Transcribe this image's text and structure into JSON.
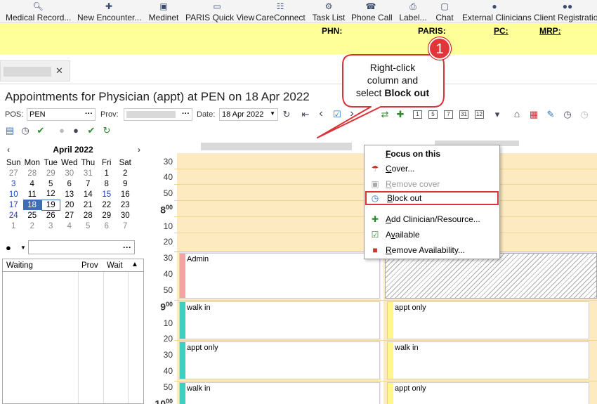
{
  "toolbar": {
    "items": [
      {
        "label": "Medical Record...",
        "icon": "search-icon"
      },
      {
        "label": "New Encounter...",
        "icon": "new-encounter-icon"
      },
      {
        "label": "Medinet",
        "icon": "medinet-icon"
      },
      {
        "label": "PARIS Quick View",
        "icon": "window-icon"
      },
      {
        "label": "CareConnect",
        "icon": "careconnect-icon"
      },
      {
        "label": "Task List",
        "icon": "gears-icon"
      },
      {
        "label": "Phone Call",
        "icon": "phone-icon"
      },
      {
        "label": "Label...",
        "icon": "printer-icon"
      },
      {
        "label": "Chat",
        "icon": "chat-icon"
      },
      {
        "label": "External Clinicians",
        "icon": "person-icon"
      },
      {
        "label": "Client Registration",
        "icon": "people-icon"
      }
    ]
  },
  "patient_banner": {
    "phn_label": "PHN:",
    "paris_label": "PARIS:",
    "pc_label": "PC:",
    "mrp_label": "MRP:"
  },
  "tab": {
    "close_glyph": "✕"
  },
  "page_title": "Appointments for Physician (appt) at PEN on 18 Apr 2022",
  "filters": {
    "pos_label": "POS:",
    "pos_value": "PEN",
    "prov_label": "Prov:",
    "date_label": "Date:",
    "date_value": "18 Apr 2022",
    "ellipsis": "···",
    "calendar_boxes": [
      "1",
      "5",
      "7",
      "31",
      "12"
    ]
  },
  "calendar": {
    "month_label": "April 2022",
    "weekdays": [
      "Sun",
      "Mon",
      "Tue",
      "Wed",
      "Thu",
      "Fri",
      "Sat"
    ],
    "weeks": [
      [
        "27",
        "28",
        "29",
        "30",
        "31",
        "1",
        "2"
      ],
      [
        "3",
        "4",
        "5",
        "6",
        "7",
        "8",
        "9"
      ],
      [
        "10",
        "11",
        "12",
        "13",
        "14",
        "15",
        "16"
      ],
      [
        "17",
        "18",
        "19",
        "20",
        "21",
        "22",
        "23"
      ],
      [
        "24",
        "25",
        "26",
        "27",
        "28",
        "29",
        "30"
      ],
      [
        "1",
        "2",
        "3",
        "4",
        "5",
        "6",
        "7"
      ]
    ]
  },
  "waitlist": {
    "columns": [
      "Waiting",
      "Prov",
      "Wait"
    ]
  },
  "schedule": {
    "time_labels": [
      "30",
      "40",
      "50",
      "8",
      "10",
      "20",
      "30",
      "40",
      "50",
      "9",
      "10",
      "20",
      "30",
      "40",
      "50",
      "10"
    ],
    "hour_suffix": "00",
    "appointments_col1": [
      {
        "label": "Admin",
        "color": "#f4a3a3"
      },
      {
        "label": "walk in",
        "color": "#3ecfc3"
      },
      {
        "label": "appt only",
        "color": "#3ecfc3"
      },
      {
        "label": "walk in",
        "color": "#3ecfc3"
      }
    ],
    "appointments_col2": [
      {
        "label": "appt only",
        "color": "#fff78a"
      },
      {
        "label": "walk in",
        "color": "#fff78a"
      },
      {
        "label": "appt only",
        "color": "#fff78a"
      }
    ]
  },
  "context_menu": {
    "items": [
      {
        "label": "Focus on this",
        "accel": "F",
        "rest": "ocus on this",
        "bold": true,
        "disabled": false,
        "icon": ""
      },
      {
        "label": "Cover...",
        "accel": "C",
        "rest": "over...",
        "disabled": false,
        "icon": "umbrella-icon"
      },
      {
        "label": "Remove cover",
        "accel": "R",
        "rest": "emove cover",
        "disabled": true,
        "icon": "remove-cover-icon"
      },
      {
        "label": "Block out",
        "accel": "B",
        "rest": "lock out",
        "disabled": false,
        "icon": "block-out-icon",
        "highlight": true
      },
      {
        "label": "Add Clinician/Resource...",
        "accel": "A",
        "rest": "dd Clinician/Resource...",
        "disabled": false,
        "icon": "add-people-icon"
      },
      {
        "label": "Available",
        "accel": "v",
        "pre": "A",
        "rest": "ailable",
        "disabled": false,
        "icon": "available-icon"
      },
      {
        "label": "Remove Availability...",
        "accel": "R",
        "rest": "emove Availability...",
        "disabled": false,
        "icon": "remove-availability-icon"
      }
    ]
  },
  "callout": {
    "badge_number": "1",
    "text_line1": "Right-click",
    "text_line2": "column and",
    "text_line3_pre": "select ",
    "text_line3_bold": "Block out"
  }
}
